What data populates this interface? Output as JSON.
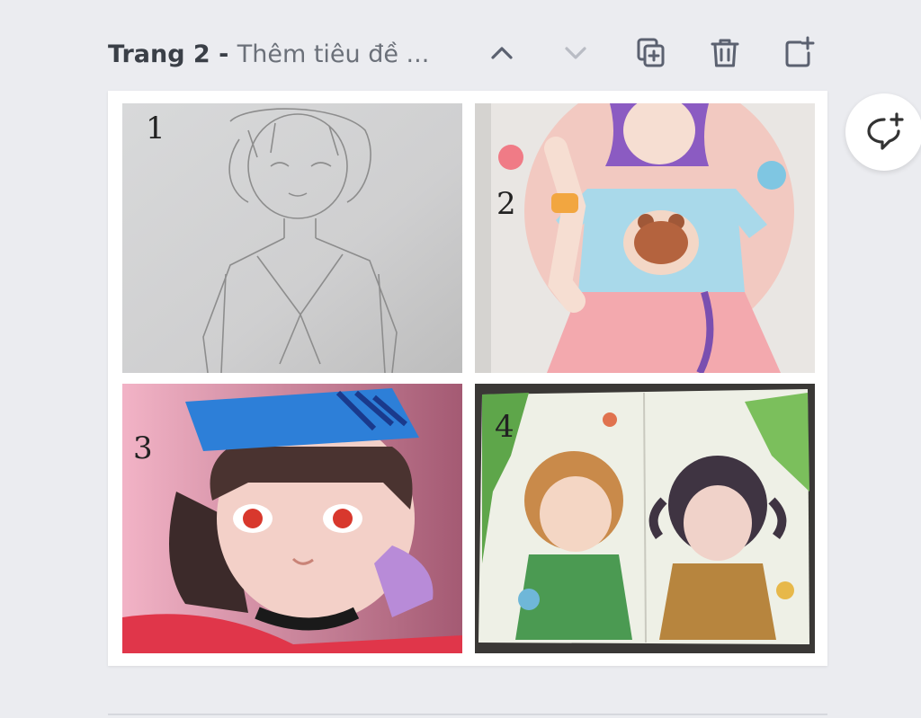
{
  "page": {
    "label": "Trang 2 - ",
    "title_placeholder": "Thêm tiêu đề ..."
  },
  "toolbar": {
    "icons": [
      "chevron-up-icon",
      "chevron-down-icon",
      "duplicate-page-icon",
      "trash-icon",
      "add-page-icon"
    ]
  },
  "artworks": [
    {
      "number": "1",
      "description": "pencil sketch"
    },
    {
      "number": "2",
      "description": "bear t-shirt girl"
    },
    {
      "number": "3",
      "description": "blue headband portrait"
    },
    {
      "number": "4",
      "description": "watercolor children"
    }
  ],
  "colors": {
    "background": "#ebecf0",
    "card": "#ffffff",
    "icon": "#5b6170",
    "icon_disabled": "#b9bcc4"
  }
}
